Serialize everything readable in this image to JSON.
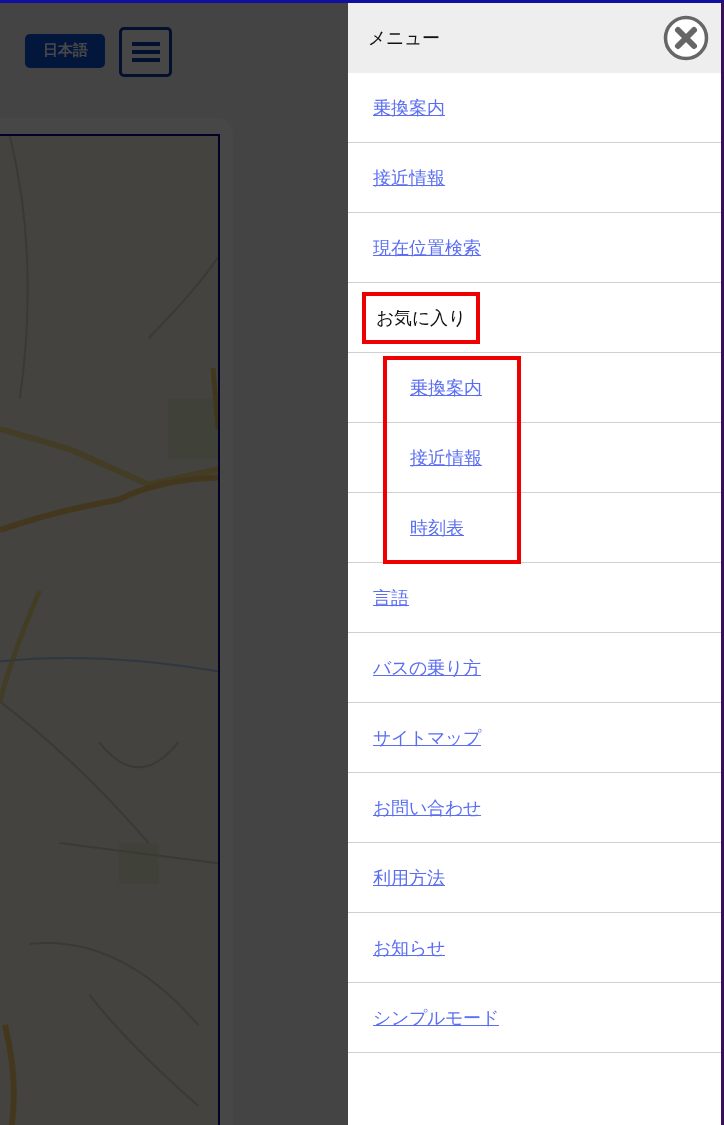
{
  "page": {
    "language_button": "日本語"
  },
  "menu": {
    "title": "メニュー",
    "items": [
      {
        "label": "乗換案内",
        "kind": "link"
      },
      {
        "label": "接近情報",
        "kind": "link"
      },
      {
        "label": "現在位置検索",
        "kind": "link"
      },
      {
        "label": "お気に入り",
        "kind": "group",
        "highlighted": true,
        "children_highlighted": true,
        "children": [
          {
            "label": "乗換案内",
            "kind": "link"
          },
          {
            "label": "接近情報",
            "kind": "link"
          },
          {
            "label": "時刻表",
            "kind": "link"
          }
        ]
      },
      {
        "label": "言語",
        "kind": "link"
      },
      {
        "label": "バスの乗り方",
        "kind": "link"
      },
      {
        "label": "サイトマップ",
        "kind": "link"
      },
      {
        "label": "お問い合わせ",
        "kind": "link"
      },
      {
        "label": "利用方法",
        "kind": "link"
      },
      {
        "label": "お知らせ",
        "kind": "link"
      },
      {
        "label": "シンプルモード",
        "kind": "link"
      }
    ]
  }
}
